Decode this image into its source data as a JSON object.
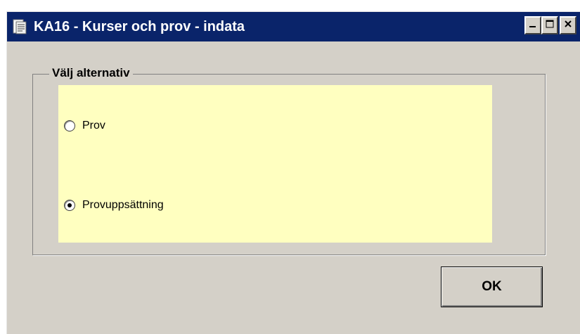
{
  "window": {
    "title": "KA16 - Kurser och prov - indata",
    "icon": "document-icon",
    "controls": [
      "minimize-icon",
      "maximize-icon",
      "close-icon"
    ]
  },
  "group": {
    "legend": "Välj alternativ",
    "options": [
      {
        "label": "Prov",
        "selected": false
      },
      {
        "label": "Provuppsättning",
        "selected": true
      }
    ]
  },
  "buttons": {
    "ok_label": "OK"
  },
  "colors": {
    "titlebar": "#0a246a",
    "window_bg": "#d4d0c8",
    "panel_bg": "#ffffc0"
  }
}
